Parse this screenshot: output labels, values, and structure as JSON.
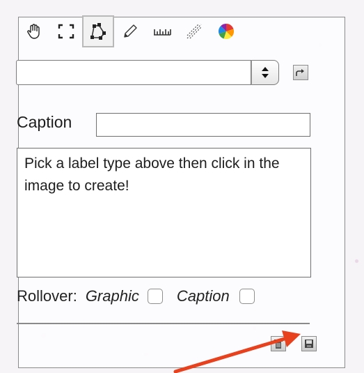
{
  "toolbar": {
    "tools": [
      {
        "icon": "hand-icon",
        "active": false
      },
      {
        "icon": "rectangle-select-icon",
        "active": false
      },
      {
        "icon": "polygon-icon",
        "active": true
      },
      {
        "icon": "pencil-icon",
        "active": false
      },
      {
        "icon": "ruler-icon",
        "active": false
      },
      {
        "icon": "line-tool-icon",
        "active": false
      },
      {
        "icon": "color-wheel-icon",
        "active": false
      }
    ]
  },
  "label_type": {
    "selected_value": ""
  },
  "caption": {
    "label": "Caption",
    "value": ""
  },
  "message": {
    "text": "Pick a label type above then click in the image to create!"
  },
  "rollover": {
    "label": "Rollover:",
    "graphic_label": "Graphic",
    "graphic_checked": false,
    "caption_label": "Caption",
    "caption_checked": false
  },
  "footer": {
    "buttons": [
      {
        "icon": "trash-icon"
      },
      {
        "icon": "save-icon"
      }
    ]
  },
  "colors": {
    "annotation_arrow": "#e8411e",
    "panel_border": "#8a8a8a",
    "active_tool_border": "#b9b9b9"
  }
}
